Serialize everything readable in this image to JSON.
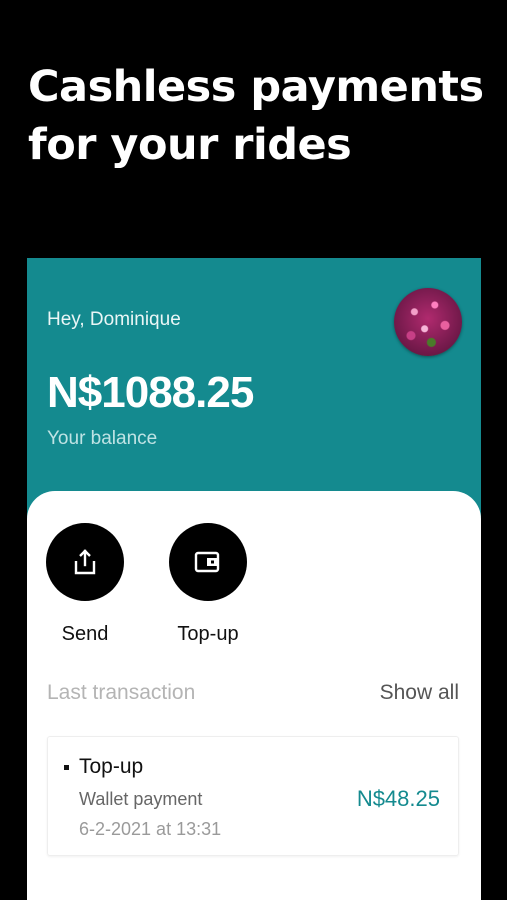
{
  "headline": {
    "line1": "Cashless payments",
    "line2": "for your rides"
  },
  "wallet": {
    "greeting": "Hey, Dominique",
    "balance": "N$1088.25",
    "balance_label": "Your balance",
    "accent_color": "#148a8f"
  },
  "actions": {
    "send": {
      "label": "Send",
      "icon": "share-upload-icon"
    },
    "topup": {
      "label": "Top-up",
      "icon": "wallet-icon"
    }
  },
  "transactions": {
    "title": "Last transaction",
    "show_all": "Show all",
    "items": [
      {
        "type": "Top-up",
        "description": "Wallet payment",
        "date": "6-2-2021 at 13:31",
        "amount": "N$48.25"
      }
    ]
  }
}
